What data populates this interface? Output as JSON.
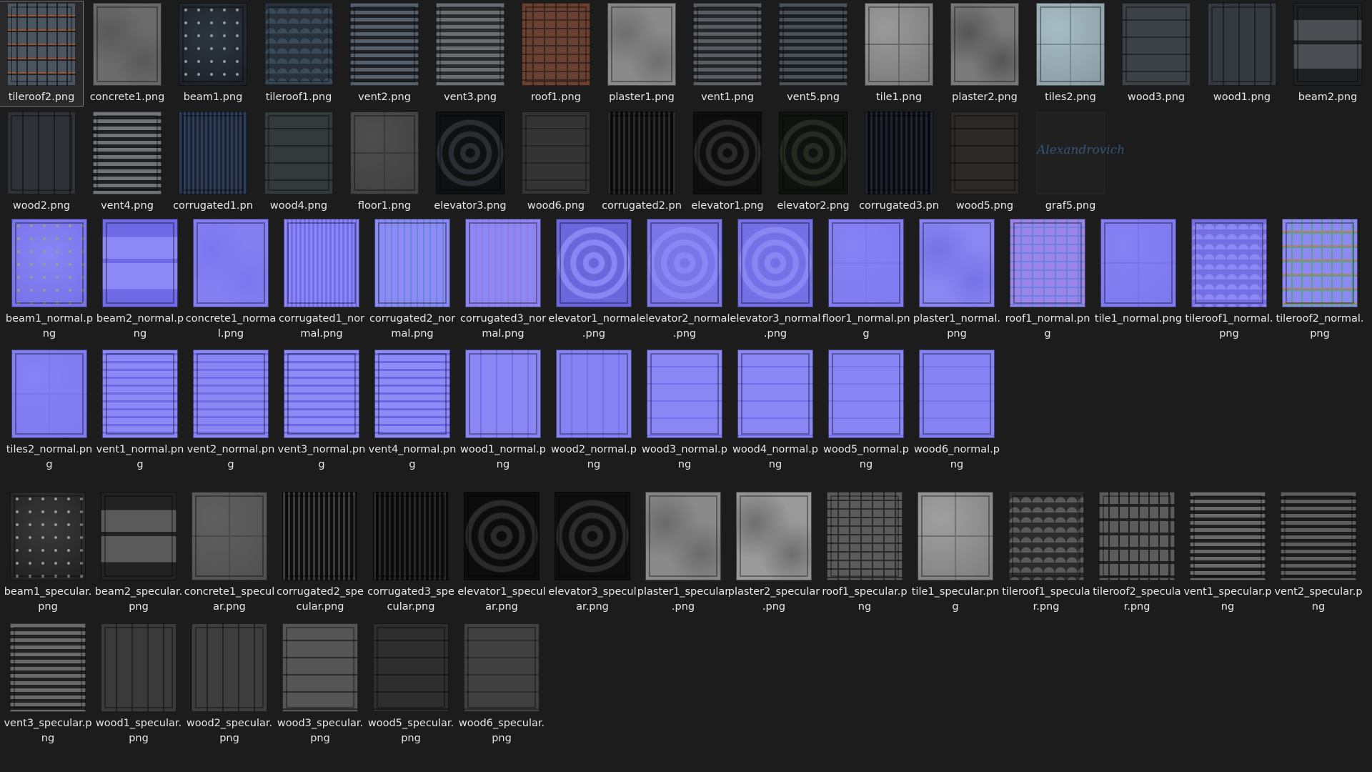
{
  "window": {
    "background": "#1c1c1c",
    "view": "Large icons"
  },
  "sections": [
    {
      "id": "diffuse-row-1",
      "items": [
        {
          "file": "tileroof2.png",
          "label": [
            "tileroof2.png"
          ],
          "pattern": "shingles",
          "colors": [
            "#4a5560",
            "#1e2428"
          ],
          "accent": "#a0522d",
          "selected": true
        },
        {
          "file": "concrete1.png",
          "label": [
            "concrete1.png"
          ],
          "pattern": "noise",
          "colors": [
            "#6b6b6b",
            "#595959"
          ]
        },
        {
          "file": "beam1.png",
          "label": [
            "beam1.png"
          ],
          "pattern": "rivets",
          "colors": [
            "#2d3640",
            "#1b2026"
          ]
        },
        {
          "file": "tileroof1.png",
          "label": [
            "tileroof1.png"
          ],
          "pattern": "scales",
          "colors": [
            "#3b4a58",
            "#27313b"
          ]
        },
        {
          "file": "vent2.png",
          "label": [
            "vent2.png"
          ],
          "pattern": "louver",
          "colors": [
            "#55606a",
            "#1e2226"
          ],
          "accent": "#7a4a2a"
        },
        {
          "file": "vent3.png",
          "label": [
            "vent3.png"
          ],
          "pattern": "louver",
          "colors": [
            "#6a6e72",
            "#2a2c2e"
          ]
        },
        {
          "file": "roof1.png",
          "label": [
            "roof1.png"
          ],
          "pattern": "bricks",
          "colors": [
            "#6a4030",
            "#3a2a24"
          ]
        },
        {
          "file": "plaster1.png",
          "label": [
            "plaster1.png"
          ],
          "pattern": "noise",
          "colors": [
            "#8a8a8a",
            "#6e6e6e"
          ]
        },
        {
          "file": "vent1.png",
          "label": [
            "vent1.png"
          ],
          "pattern": "louver",
          "colors": [
            "#5a5e62",
            "#24262a"
          ]
        },
        {
          "file": "vent5.png",
          "label": [
            "vent5.png"
          ],
          "pattern": "louver",
          "colors": [
            "#4a5258",
            "#1c2024"
          ]
        },
        {
          "file": "tile1.png",
          "label": [
            "tile1.png"
          ],
          "pattern": "tiles4",
          "colors": [
            "#9a9a9a",
            "#6a6a6a"
          ]
        },
        {
          "file": "plaster2.png",
          "label": [
            "plaster2.png"
          ],
          "pattern": "noise",
          "colors": [
            "#7a7a7a",
            "#555555"
          ]
        },
        {
          "file": "tiles2.png",
          "label": [
            "tiles2.png"
          ],
          "pattern": "tiles4",
          "colors": [
            "#a8bcc4",
            "#7a8c94"
          ]
        },
        {
          "file": "wood3.png",
          "label": [
            "wood3.png"
          ],
          "pattern": "planksH",
          "colors": [
            "#3c4248",
            "#22272c"
          ]
        },
        {
          "file": "wood1.png",
          "label": [
            "wood1.png"
          ],
          "pattern": "planksV",
          "colors": [
            "#343a40",
            "#1e2226"
          ]
        },
        {
          "file": "beam2.png",
          "label": [
            "beam2.png"
          ],
          "pattern": "beam",
          "colors": [
            "#4a4e52",
            "#1e2022"
          ]
        }
      ]
    },
    {
      "id": "diffuse-row-2",
      "items": [
        {
          "file": "wood2.png",
          "label": [
            "wood2.png"
          ],
          "pattern": "planksV",
          "colors": [
            "#2e3236",
            "#1a1c1e"
          ]
        },
        {
          "file": "vent4.png",
          "label": [
            "vent4.png"
          ],
          "pattern": "louver",
          "colors": [
            "#707478",
            "#1e2022"
          ]
        },
        {
          "file": "corrugated1.png",
          "label": [
            "corrugated1.pn"
          ],
          "pattern": "plaid",
          "colors": [
            "#2e3e58",
            "#1a2232"
          ]
        },
        {
          "file": "wood4.png",
          "label": [
            "wood4.png"
          ],
          "pattern": "planksH",
          "colors": [
            "#323a3a",
            "#1e2424"
          ]
        },
        {
          "file": "floor1.png",
          "label": [
            "floor1.png"
          ],
          "pattern": "tiles4",
          "colors": [
            "#4e4e4e",
            "#3a3a3a"
          ]
        },
        {
          "file": "elevator3.png",
          "label": [
            "elevator3.png"
          ],
          "pattern": "tunnel",
          "colors": [
            "#2a2e32",
            "#0e1012"
          ]
        },
        {
          "file": "wood6.png",
          "label": [
            "wood6.png"
          ],
          "pattern": "planksH",
          "colors": [
            "#343434",
            "#262626"
          ]
        },
        {
          "file": "corrugated2.png",
          "label": [
            "corrugated2.pn"
          ],
          "pattern": "stripesV",
          "colors": [
            "#2a2a2a",
            "#0c0c0c"
          ]
        },
        {
          "file": "elevator1.png",
          "label": [
            "elevator1.png"
          ],
          "pattern": "tunnel",
          "colors": [
            "#2a2a2a",
            "#0e0e0e"
          ]
        },
        {
          "file": "elevator2.png",
          "label": [
            "elevator2.png"
          ],
          "pattern": "tunnel",
          "colors": [
            "#262a22",
            "#101210"
          ]
        },
        {
          "file": "corrugated3.png",
          "label": [
            "corrugated3.pn"
          ],
          "pattern": "stripesV",
          "colors": [
            "#1e2430",
            "#0a0c10"
          ]
        },
        {
          "file": "wood5.png",
          "label": [
            "wood5.png"
          ],
          "pattern": "planksH",
          "colors": [
            "#2c2a28",
            "#1a1816"
          ],
          "accent": "#6a2a1a"
        },
        {
          "file": "graf5.png",
          "label": [
            "graf5.png"
          ],
          "pattern": "graf",
          "colors": [
            "#202020",
            "#1c1c1c"
          ],
          "graf_text": "Alexandrovich"
        }
      ]
    },
    {
      "id": "normal-row-1",
      "items": [
        {
          "file": "beam1_normal.png",
          "label": [
            "beam1_normal.p",
            "ng"
          ],
          "pattern": "rivets",
          "colors": [
            "#8a86f4",
            "#7470e8"
          ]
        },
        {
          "file": "beam2_normal.png",
          "label": [
            "beam2_normal.p",
            "ng"
          ],
          "pattern": "beam",
          "colors": [
            "#8c88f6",
            "#6e6ae6"
          ]
        },
        {
          "file": "concrete1_normal.png",
          "label": [
            "concrete1_norma",
            "l.png"
          ],
          "pattern": "noise",
          "colors": [
            "#8480f2",
            "#7a76ee"
          ]
        },
        {
          "file": "corrugated1_normal.png",
          "label": [
            "corrugated1_nor",
            "mal.png"
          ],
          "pattern": "plaid",
          "colors": [
            "#8c88f8",
            "#726ee8"
          ]
        },
        {
          "file": "corrugated2_normal.png",
          "label": [
            "corrugated2_nor",
            "mal.png"
          ],
          "pattern": "stripesVn",
          "colors": [
            "#8e8af8",
            "#6a8ad0"
          ]
        },
        {
          "file": "corrugated3_normal.png",
          "label": [
            "corrugated3_nor",
            "mal.png"
          ],
          "pattern": "stripesVn",
          "colors": [
            "#8c88f6",
            "#9a7ad8"
          ]
        },
        {
          "file": "elevator1_normal.png",
          "label": [
            "elevator1_normal",
            ".png"
          ],
          "pattern": "tunnel",
          "colors": [
            "#8a86f4",
            "#6a66dc"
          ]
        },
        {
          "file": "elevator2_normal.png",
          "label": [
            "elevator2_normal",
            ".png"
          ],
          "pattern": "tunnel",
          "colors": [
            "#8a86f4",
            "#7a76e8"
          ]
        },
        {
          "file": "elevator3_normal.png",
          "label": [
            "elevator3_normal",
            ".png"
          ],
          "pattern": "tunnel",
          "colors": [
            "#8a86f4",
            "#7470e6"
          ]
        },
        {
          "file": "floor1_normal.png",
          "label": [
            "floor1_normal.pn",
            "g"
          ],
          "pattern": "tiles4",
          "colors": [
            "#8682f4",
            "#7c78ee"
          ]
        },
        {
          "file": "plaster1_normal.png",
          "label": [
            "plaster1_normal.",
            "png"
          ],
          "pattern": "noise",
          "colors": [
            "#8a86f2",
            "#7672e6"
          ]
        },
        {
          "file": "roof1_normal.png",
          "label": [
            "roof1_normal.pn",
            "g"
          ],
          "pattern": "bricks",
          "colors": [
            "#9a86e8",
            "#6e80e0"
          ]
        },
        {
          "file": "tile1_normal.png",
          "label": [
            "tile1_normal.png"
          ],
          "pattern": "tiles4",
          "colors": [
            "#8682f4",
            "#7874ec"
          ]
        },
        {
          "file": "tileroof1_normal.png",
          "label": [
            "tileroof1_normal.",
            "png"
          ],
          "pattern": "scales",
          "colors": [
            "#8c88f4",
            "#7470e4"
          ]
        },
        {
          "file": "tileroof2_normal.png",
          "label": [
            "tileroof2_normal.",
            "png"
          ],
          "pattern": "shingles",
          "colors": [
            "#8e8af4",
            "#5aa08a"
          ],
          "accent": "#c07a6a"
        }
      ]
    },
    {
      "id": "normal-row-2",
      "items": [
        {
          "file": "tiles2_normal.png",
          "label": [
            "tiles2_normal.pn",
            "g"
          ],
          "pattern": "tiles4",
          "colors": [
            "#8682f4",
            "#7a76ee"
          ]
        },
        {
          "file": "vent1_normal.png",
          "label": [
            "vent1_normal.pn",
            "g"
          ],
          "pattern": "louverN",
          "colors": [
            "#8c88f6",
            "#6e6ae6"
          ]
        },
        {
          "file": "vent2_normal.png",
          "label": [
            "vent2_normal.pn",
            "g"
          ],
          "pattern": "louverN",
          "colors": [
            "#8a86f4",
            "#706ce6"
          ]
        },
        {
          "file": "vent3_normal.png",
          "label": [
            "vent3_normal.pn",
            "g"
          ],
          "pattern": "louverN",
          "colors": [
            "#8e8af6",
            "#6c68e4"
          ]
        },
        {
          "file": "vent4_normal.png",
          "label": [
            "vent4_normal.pn",
            "g"
          ],
          "pattern": "louverN",
          "colors": [
            "#8e8af6",
            "#6a66e2"
          ]
        },
        {
          "file": "wood1_normal.png",
          "label": [
            "wood1_normal.p",
            "ng"
          ],
          "pattern": "planksV",
          "colors": [
            "#8a86f4",
            "#7470e8"
          ]
        },
        {
          "file": "wood2_normal.png",
          "label": [
            "wood2_normal.p",
            "ng"
          ],
          "pattern": "planksV",
          "colors": [
            "#8682f4",
            "#7672ea"
          ]
        },
        {
          "file": "wood3_normal.png",
          "label": [
            "wood3_normal.p",
            "ng"
          ],
          "pattern": "planksH",
          "colors": [
            "#8a86f4",
            "#7470e8"
          ]
        },
        {
          "file": "wood4_normal.png",
          "label": [
            "wood4_normal.p",
            "ng"
          ],
          "pattern": "planksH",
          "colors": [
            "#8a86f4",
            "#726ee8"
          ]
        },
        {
          "file": "wood5_normal.png",
          "label": [
            "wood5_normal.p",
            "ng"
          ],
          "pattern": "planksH",
          "colors": [
            "#8884f4",
            "#7874ec"
          ]
        },
        {
          "file": "wood6_normal.png",
          "label": [
            "wood6_normal.p",
            "ng"
          ],
          "pattern": "planksH",
          "colors": [
            "#8682f4",
            "#7a76ee"
          ]
        }
      ]
    },
    {
      "id": "specular-row-1",
      "items": [
        {
          "file": "beam1_specular.png",
          "label": [
            "beam1_specular.",
            "png"
          ],
          "pattern": "rivets",
          "colors": [
            "#3a3a3a",
            "#202020"
          ]
        },
        {
          "file": "beam2_specular.png",
          "label": [
            "beam2_specular.",
            "png"
          ],
          "pattern": "beam",
          "colors": [
            "#5a5a5a",
            "#222222"
          ]
        },
        {
          "file": "concrete1_specular.png",
          "label": [
            "concrete1_specul",
            "ar.png"
          ],
          "pattern": "tiles4",
          "colors": [
            "#606060",
            "#4a4a4a"
          ]
        },
        {
          "file": "corrugated2_specular.png",
          "label": [
            "corrugated2_spe",
            "cular.png"
          ],
          "pattern": "stripesV",
          "colors": [
            "#3a3a3a",
            "#0e0e0e"
          ]
        },
        {
          "file": "corrugated3_specular.png",
          "label": [
            "corrugated3_spe",
            "cular.png"
          ],
          "pattern": "stripesV",
          "colors": [
            "#262626",
            "#0a0a0a"
          ]
        },
        {
          "file": "elevator1_specular.png",
          "label": [
            "elevator1_specul",
            "ar.png"
          ],
          "pattern": "tunnel",
          "colors": [
            "#2a2a2a",
            "#0c0c0c"
          ]
        },
        {
          "file": "elevator3_specular.png",
          "label": [
            "elevator3_specul",
            "ar.png"
          ],
          "pattern": "tunnel",
          "colors": [
            "#2c2c2c",
            "#0e0e0e"
          ]
        },
        {
          "file": "plaster1_specular.png",
          "label": [
            "plaster1_specular",
            ".png"
          ],
          "pattern": "noise",
          "colors": [
            "#8a8a8a",
            "#6a6a6a"
          ]
        },
        {
          "file": "plaster2_specular.png",
          "label": [
            "plaster2_specular",
            ".png"
          ],
          "pattern": "noise",
          "colors": [
            "#9a9a9a",
            "#6e6e6e"
          ]
        },
        {
          "file": "roof1_specular.png",
          "label": [
            "roof1_specular.p",
            "ng"
          ],
          "pattern": "bricks",
          "colors": [
            "#5a5a5a",
            "#2a2a2a"
          ]
        },
        {
          "file": "tile1_specular.png",
          "label": [
            "tile1_specular.pn",
            "g"
          ],
          "pattern": "tiles4",
          "colors": [
            "#a0a0a0",
            "#707070"
          ]
        },
        {
          "file": "tileroof1_specular.png",
          "label": [
            "tileroof1_specula",
            "r.png"
          ],
          "pattern": "scales",
          "colors": [
            "#5a5a5a",
            "#2c2c2c"
          ]
        },
        {
          "file": "tileroof2_specular.png",
          "label": [
            "tileroof2_specula",
            "r.png"
          ],
          "pattern": "shingles",
          "colors": [
            "#5c5c5c",
            "#222222"
          ]
        },
        {
          "file": "vent1_specular.png",
          "label": [
            "vent1_specular.p",
            "ng"
          ],
          "pattern": "louver",
          "colors": [
            "#6a6a6a",
            "#1e1e1e"
          ]
        },
        {
          "file": "vent2_specular.png",
          "label": [
            "vent2_specular.p",
            "ng"
          ],
          "pattern": "louver",
          "colors": [
            "#5e5e5e",
            "#1c1c1c"
          ]
        }
      ]
    },
    {
      "id": "specular-row-2",
      "items": [
        {
          "file": "vent3_specular.png",
          "label": [
            "vent3_specular.p",
            "ng"
          ],
          "pattern": "louver",
          "colors": [
            "#6a6a6a",
            "#222222"
          ]
        },
        {
          "file": "wood1_specular.png",
          "label": [
            "wood1_specular.",
            "png"
          ],
          "pattern": "planksV",
          "colors": [
            "#3a3a3a",
            "#222222"
          ]
        },
        {
          "file": "wood2_specular.png",
          "label": [
            "wood2_specular.",
            "png"
          ],
          "pattern": "planksV",
          "colors": [
            "#3e3e3e",
            "#242424"
          ]
        },
        {
          "file": "wood3_specular.png",
          "label": [
            "wood3_specular.",
            "png"
          ],
          "pattern": "planksH",
          "colors": [
            "#555555",
            "#2c2c2c"
          ]
        },
        {
          "file": "wood5_specular.png",
          "label": [
            "wood5_specular.",
            "png"
          ],
          "pattern": "planksH",
          "colors": [
            "#2e2e2e",
            "#1a1a1a"
          ]
        },
        {
          "file": "wood6_specular.png",
          "label": [
            "wood6_specular.",
            "png"
          ],
          "pattern": "planksH",
          "colors": [
            "#404040",
            "#2c2c2c"
          ]
        }
      ]
    }
  ]
}
